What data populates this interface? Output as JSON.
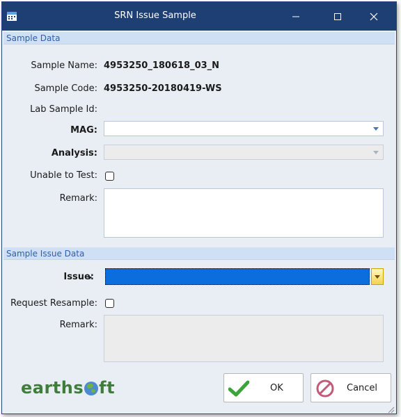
{
  "window": {
    "title": "SRN Issue Sample"
  },
  "sample_data": {
    "header": "Sample Data",
    "sample_name_label": "Sample Name:",
    "sample_name_value": "4953250_180618_03_N",
    "sample_code_label": "Sample Code:",
    "sample_code_value": "4953250-20180419-WS",
    "lab_sample_id_label": "Lab Sample Id:",
    "mag_label": "MAG:",
    "mag_value": "",
    "analysis_label": "Analysis:",
    "analysis_value": "",
    "unable_to_test_label": "Unable to Test:",
    "unable_to_test_checked": false,
    "remark_label": "Remark:",
    "remark_value": ""
  },
  "issue_data": {
    "header": "Sample Issue Data",
    "issue_label": "Issue:",
    "issue_value": "",
    "request_resample_label": "Request Resample:",
    "request_resample_checked": false,
    "remark_label": "Remark:",
    "remark_value": ""
  },
  "footer": {
    "logo_text_left": "earths",
    "logo_text_right": "ft",
    "ok_label": "OK",
    "cancel_label": "Cancel"
  },
  "colors": {
    "titlebar": "#1e3f73",
    "section_header": "#cfe0f4",
    "selected_issue": "#0c6ddc",
    "ok_green": "#3aa33a",
    "cancel_red": "#c25a78",
    "logo_green": "#3f7d3a"
  },
  "icons": {
    "app": "calendar-icon",
    "minimize": "minimize-icon",
    "maximize": "maximize-icon",
    "close": "close-icon",
    "ok": "checkmark-icon",
    "cancel": "prohibited-icon"
  }
}
